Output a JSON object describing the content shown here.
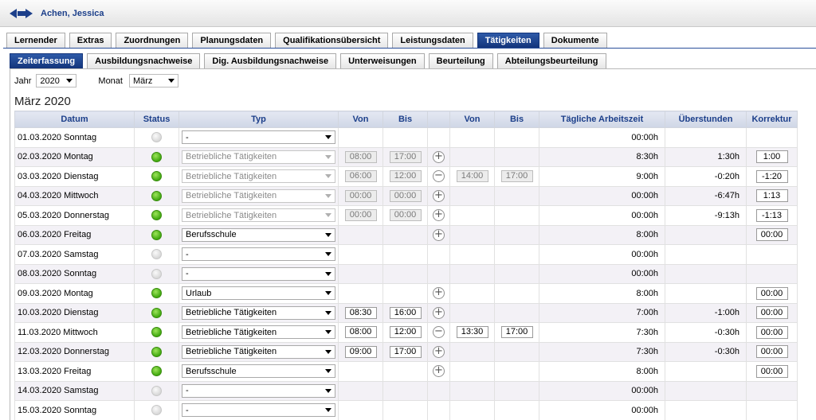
{
  "header": {
    "user_name": "Achen, Jessica"
  },
  "main_tabs": [
    {
      "label": "Lernender",
      "active": false
    },
    {
      "label": "Extras",
      "active": false
    },
    {
      "label": "Zuordnungen",
      "active": false
    },
    {
      "label": "Planungsdaten",
      "active": false
    },
    {
      "label": "Qualifikationsübersicht",
      "active": false
    },
    {
      "label": "Leistungsdaten",
      "active": false
    },
    {
      "label": "Tätigkeiten",
      "active": true
    },
    {
      "label": "Dokumente",
      "active": false
    }
  ],
  "sub_tabs": [
    {
      "label": "Zeiterfassung",
      "active": true
    },
    {
      "label": "Ausbildungsnachweise",
      "active": false
    },
    {
      "label": "Dig. Ausbildungsnachweise",
      "active": false
    },
    {
      "label": "Unterweisungen",
      "active": false
    },
    {
      "label": "Beurteilung",
      "active": false
    },
    {
      "label": "Abteilungsbeurteilung",
      "active": false
    }
  ],
  "filters": {
    "year_label": "Jahr",
    "year_value": "2020",
    "month_label": "Monat",
    "month_value": "März"
  },
  "month_title": "März 2020",
  "table": {
    "columns": [
      "Datum",
      "Status",
      "Typ",
      "Von",
      "Bis",
      "",
      "Von",
      "Bis",
      "Tägliche Arbeitszeit",
      "Überstunden",
      "Korrektur"
    ],
    "rows": [
      {
        "date": "01.03.2020 Sonntag",
        "status": "off",
        "type": "-",
        "type_disabled": false,
        "von1": "",
        "bis1": "",
        "t1dis": false,
        "action": "",
        "von2": "",
        "bis2": "",
        "daily": "00:00h",
        "overtime": "",
        "correction": ""
      },
      {
        "date": "02.03.2020 Montag",
        "status": "on",
        "type": "Betriebliche Tätigkeiten",
        "type_disabled": true,
        "von1": "08:00",
        "bis1": "17:00",
        "t1dis": true,
        "action": "+",
        "von2": "",
        "bis2": "",
        "daily": "8:30h",
        "overtime": "1:30h",
        "correction": "1:00"
      },
      {
        "date": "03.03.2020 Dienstag",
        "status": "on",
        "type": "Betriebliche Tätigkeiten",
        "type_disabled": true,
        "von1": "06:00",
        "bis1": "12:00",
        "t1dis": true,
        "action": "−",
        "von2": "14:00",
        "bis2": "17:00",
        "t2dis": true,
        "daily": "9:00h",
        "overtime": "-0:20h",
        "correction": "-1:20"
      },
      {
        "date": "04.03.2020 Mittwoch",
        "status": "on",
        "type": "Betriebliche Tätigkeiten",
        "type_disabled": true,
        "von1": "00:00",
        "bis1": "00:00",
        "t1dis": true,
        "action": "+",
        "von2": "",
        "bis2": "",
        "daily": "00:00h",
        "overtime": "-6:47h",
        "correction": "1:13"
      },
      {
        "date": "05.03.2020 Donnerstag",
        "status": "on",
        "type": "Betriebliche Tätigkeiten",
        "type_disabled": true,
        "von1": "00:00",
        "bis1": "00:00",
        "t1dis": true,
        "action": "+",
        "von2": "",
        "bis2": "",
        "daily": "00:00h",
        "overtime": "-9:13h",
        "correction": "-1:13"
      },
      {
        "date": "06.03.2020 Freitag",
        "status": "on",
        "type": "Berufsschule",
        "type_disabled": false,
        "von1": "",
        "bis1": "",
        "t1dis": false,
        "action": "+",
        "von2": "",
        "bis2": "",
        "daily": "8:00h",
        "overtime": "",
        "correction": "00:00"
      },
      {
        "date": "07.03.2020 Samstag",
        "status": "off",
        "type": "-",
        "type_disabled": false,
        "von1": "",
        "bis1": "",
        "t1dis": false,
        "action": "",
        "von2": "",
        "bis2": "",
        "daily": "00:00h",
        "overtime": "",
        "correction": ""
      },
      {
        "date": "08.03.2020 Sonntag",
        "status": "off",
        "type": "-",
        "type_disabled": false,
        "von1": "",
        "bis1": "",
        "t1dis": false,
        "action": "",
        "von2": "",
        "bis2": "",
        "daily": "00:00h",
        "overtime": "",
        "correction": ""
      },
      {
        "date": "09.03.2020 Montag",
        "status": "on",
        "type": "Urlaub",
        "type_disabled": false,
        "von1": "",
        "bis1": "",
        "t1dis": false,
        "action": "+",
        "von2": "",
        "bis2": "",
        "daily": "8:00h",
        "overtime": "",
        "correction": "00:00"
      },
      {
        "date": "10.03.2020 Dienstag",
        "status": "on",
        "type": "Betriebliche Tätigkeiten",
        "type_disabled": false,
        "von1": "08:30",
        "bis1": "16:00",
        "t1dis": false,
        "action": "+",
        "von2": "",
        "bis2": "",
        "daily": "7:00h",
        "overtime": "-1:00h",
        "correction": "00:00"
      },
      {
        "date": "11.03.2020 Mittwoch",
        "status": "on",
        "type": "Betriebliche Tätigkeiten",
        "type_disabled": false,
        "von1": "08:00",
        "bis1": "12:00",
        "t1dis": false,
        "action": "−",
        "von2": "13:30",
        "bis2": "17:00",
        "t2dis": false,
        "daily": "7:30h",
        "overtime": "-0:30h",
        "correction": "00:00"
      },
      {
        "date": "12.03.2020 Donnerstag",
        "status": "on",
        "type": "Betriebliche Tätigkeiten",
        "type_disabled": false,
        "von1": "09:00",
        "bis1": "17:00",
        "t1dis": false,
        "action": "+",
        "von2": "",
        "bis2": "",
        "daily": "7:30h",
        "overtime": "-0:30h",
        "correction": "00:00"
      },
      {
        "date": "13.03.2020 Freitag",
        "status": "on",
        "type": "Berufsschule",
        "type_disabled": false,
        "von1": "",
        "bis1": "",
        "t1dis": false,
        "action": "+",
        "von2": "",
        "bis2": "",
        "daily": "8:00h",
        "overtime": "",
        "correction": "00:00"
      },
      {
        "date": "14.03.2020 Samstag",
        "status": "off",
        "type": "-",
        "type_disabled": false,
        "von1": "",
        "bis1": "",
        "t1dis": false,
        "action": "",
        "von2": "",
        "bis2": "",
        "daily": "00:00h",
        "overtime": "",
        "correction": ""
      },
      {
        "date": "15.03.2020 Sonntag",
        "status": "off",
        "type": "-",
        "type_disabled": false,
        "von1": "",
        "bis1": "",
        "t1dis": false,
        "action": "",
        "von2": "",
        "bis2": "",
        "daily": "00:00h",
        "overtime": "",
        "correction": ""
      }
    ]
  }
}
